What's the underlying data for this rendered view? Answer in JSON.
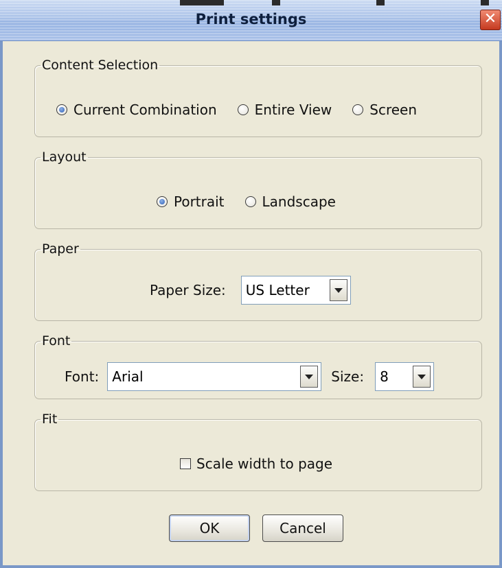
{
  "window": {
    "title": "Print settings",
    "close_glyph": "✕",
    "accent_color": "#96b3e2",
    "close_color": "#c53a20"
  },
  "content_selection": {
    "legend": "Content Selection",
    "options": [
      {
        "label": "Current Combination",
        "selected": true
      },
      {
        "label": "Entire View",
        "selected": false
      },
      {
        "label": "Screen",
        "selected": false
      }
    ]
  },
  "layout": {
    "legend": "Layout",
    "options": [
      {
        "label": "Portrait",
        "selected": true
      },
      {
        "label": "Landscape",
        "selected": false
      }
    ]
  },
  "paper": {
    "legend": "Paper",
    "size_label": "Paper Size:",
    "size_value": "US Letter"
  },
  "font": {
    "legend": "Font",
    "font_label": "Font:",
    "font_value": "Arial",
    "size_label": "Size:",
    "size_value": "8"
  },
  "fit": {
    "legend": "Fit",
    "scale_label": "Scale width to page",
    "scale_checked": false
  },
  "buttons": {
    "ok_label": "OK",
    "cancel_label": "Cancel"
  },
  "icons": {
    "close": "close-icon",
    "dropdown": "chevron-down-icon"
  }
}
